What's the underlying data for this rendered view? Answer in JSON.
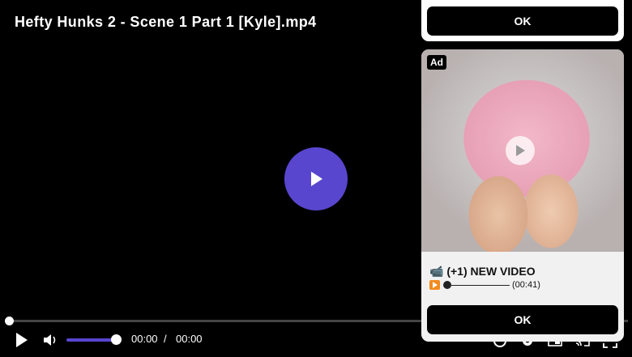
{
  "player": {
    "title": "Hefty Hunks 2 - Scene 1 Part 1 [Kyle].mp4",
    "current_time": "00:00",
    "separator": "/",
    "duration": "00:00",
    "progress": 0.0,
    "volume": 1.0,
    "accent_color": "#5846cf"
  },
  "ad_top": {
    "ok_label": "OK"
  },
  "ad": {
    "badge": "Ad",
    "headline": "📹 (+1) NEW VIDEO",
    "sub_time": "(00:41)",
    "ok_label": "OK"
  },
  "icons": [
    "play-icon",
    "volume-icon",
    "subtitles-icon",
    "settings-icon",
    "pip-icon",
    "cast-icon",
    "fullscreen-icon"
  ]
}
